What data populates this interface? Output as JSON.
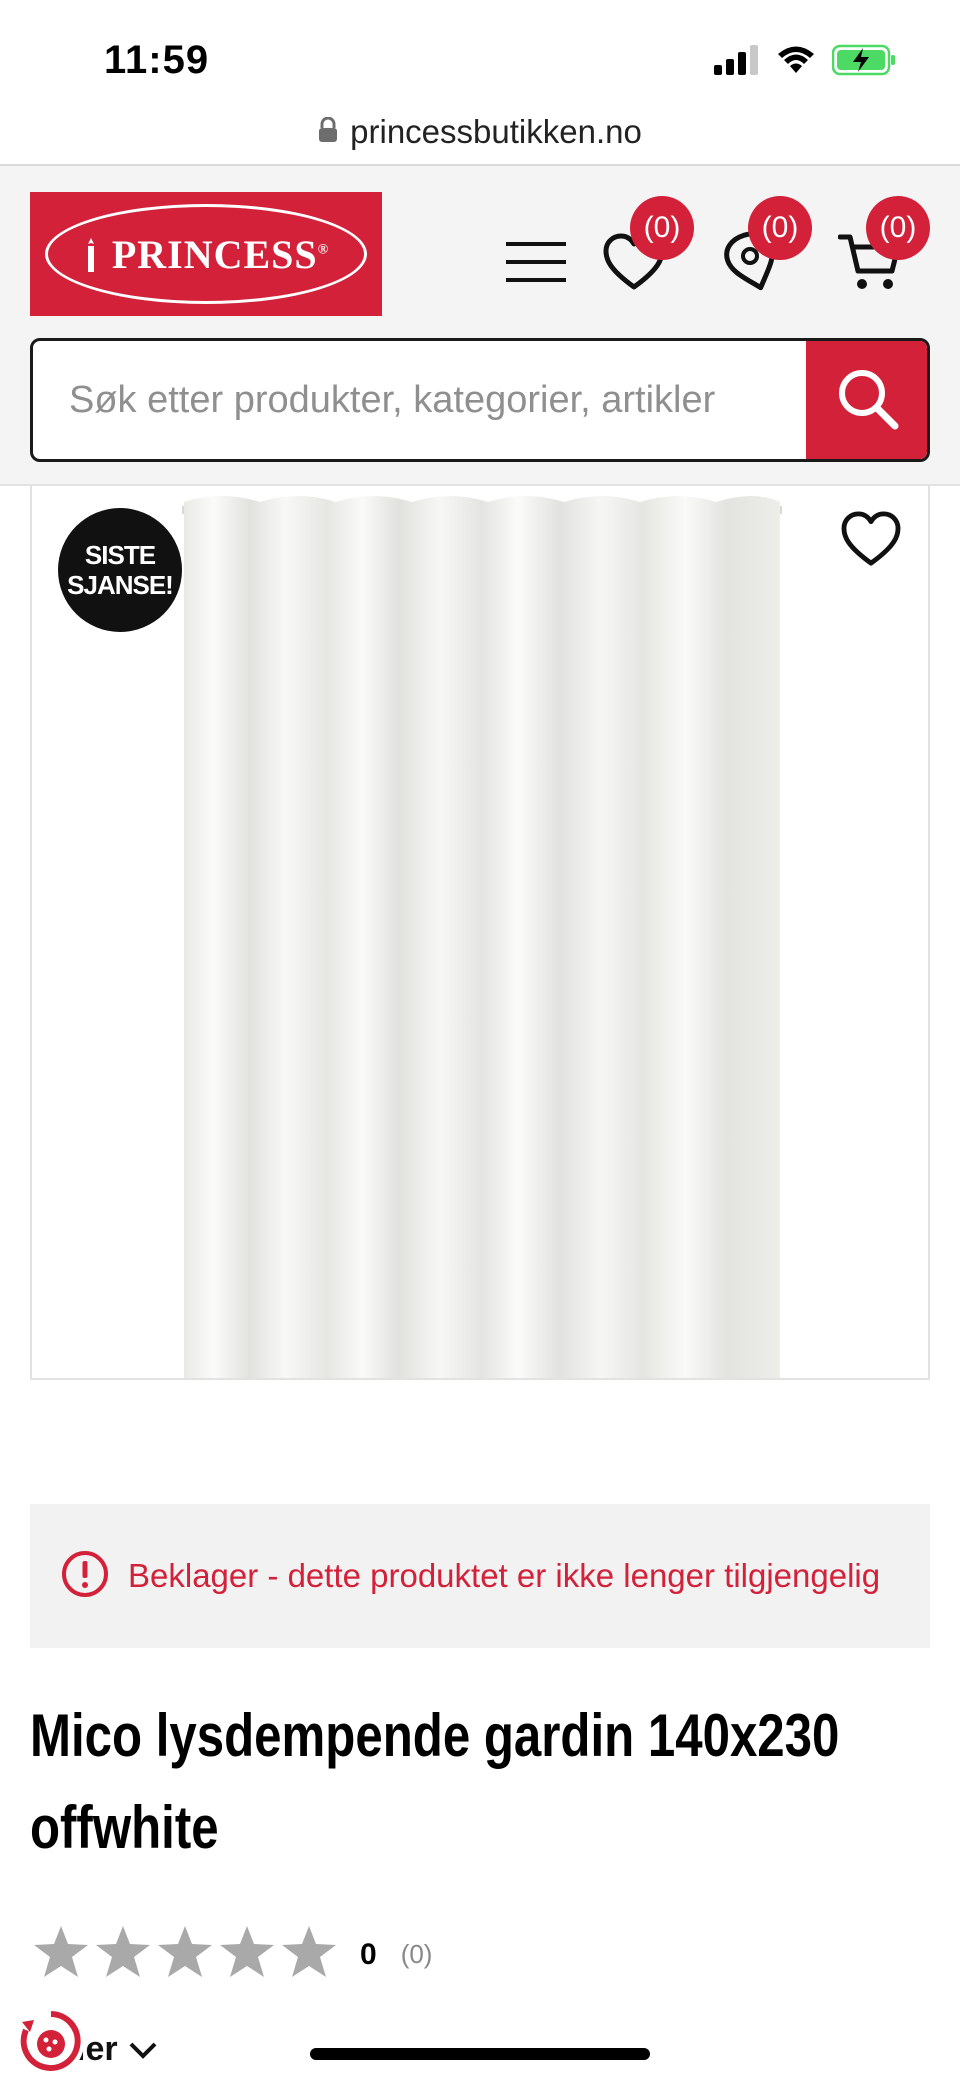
{
  "status_bar": {
    "time": "11:59"
  },
  "browser": {
    "url": "princessbutikken.no"
  },
  "header": {
    "logo_text": "PRINCESS",
    "logo_mark": "®",
    "wishlist_count": "(0)",
    "stores_count": "(0)",
    "cart_count": "(0)",
    "icons": [
      "menu-icon",
      "heart-icon",
      "location-pin-icon",
      "cart-icon"
    ]
  },
  "search": {
    "placeholder": "Søk etter produkter, kategorier, artikler",
    "value": ""
  },
  "product": {
    "badge_line1": "SISTE",
    "badge_line2": "SJANSE!",
    "unavailable_notice": "Beklager - dette produktet er ikke lenger tilgjengelig",
    "title": "Mico lysdempende gardin 140x230 offwhite",
    "rating_value": "0",
    "rating_count": "(0)",
    "rating_stars_filled": 0,
    "rating_stars_total": 5
  },
  "bottom": {
    "filter_label": "ier"
  },
  "colors": {
    "brand_red": "#d22139",
    "header_bg": "#f4f4f4",
    "notice_bg": "#f2f2f2",
    "star_empty": "#a9a9a9"
  }
}
